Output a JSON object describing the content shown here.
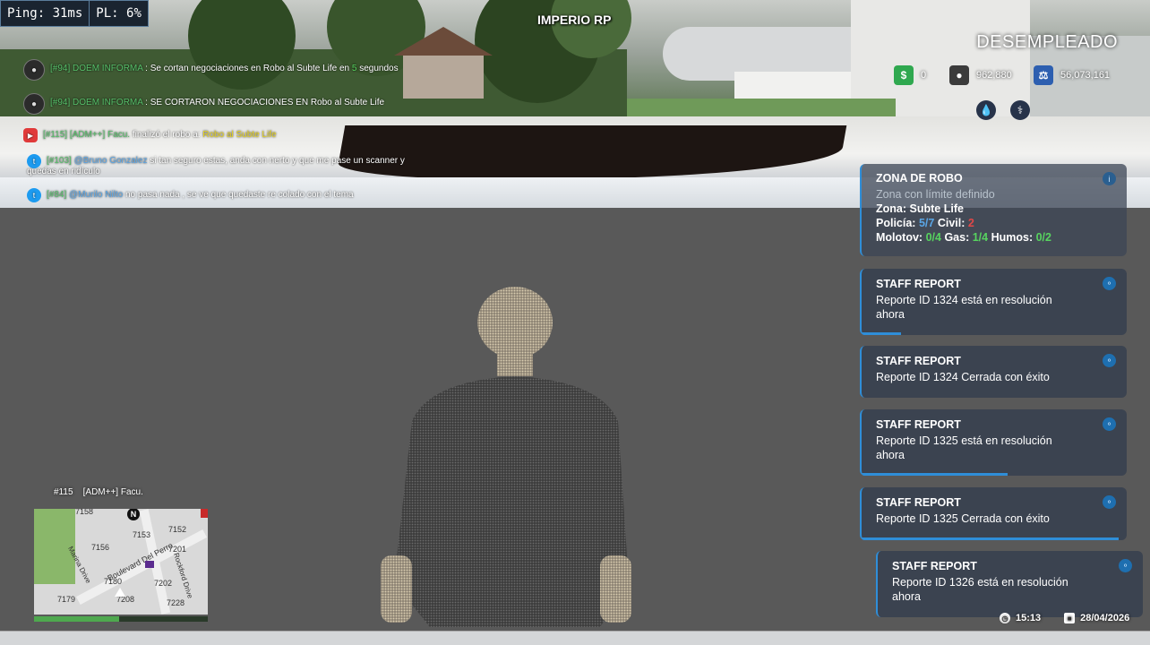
{
  "netstats": {
    "ping": "Ping: 31ms",
    "pl": "PL: 6%"
  },
  "server_name": "IMPERIO RP",
  "job": "DESEMPLEADO",
  "money": {
    "cash": "0",
    "bank_personal": "962,880",
    "bank_society": "56,073,161",
    "colors": {
      "cash": "#2fa84f",
      "person": "#3b3b3b",
      "bank": "#2d5fb0"
    }
  },
  "chat": [
    {
      "icon": "avatar",
      "tag": "[#94]",
      "sender": "DOEM INFORMA",
      "sep": " : ",
      "text": "Se cortan negociaciones en Robo al Subte Life en ",
      "highlight": "5",
      "tail": " segundos"
    },
    {
      "icon": "avatar",
      "tag": "[#94]",
      "sender": "DOEM INFORMA",
      "sep": " : ",
      "text": "SE CORTARON NEGOCIACIONES EN Robo al Subte Life",
      "highlight": "",
      "tail": ""
    },
    {
      "icon": "youtube",
      "tag": "[#115]",
      "sender": "[ADM++] Facu.",
      "sep": " ",
      "text": "finalizó el robo a: ",
      "highlight": "Robo al Subte Life",
      "tail": ""
    },
    {
      "icon": "twitter",
      "tag": "[#103]",
      "sender": "@Bruno Gonzalez",
      "sep": " ",
      "text": "si tan seguro estas, anda con nerto y que me pase un scanner y",
      "highlight": "",
      "tail": "",
      "line2": "quedas en ridículo"
    },
    {
      "icon": "twitter",
      "tag": "[#84]",
      "sender": "@Murilo Nilto",
      "sep": " ",
      "text": "no pasa nada , se ve que quedaste re colado con el tema",
      "highlight": "",
      "tail": ""
    }
  ],
  "zone": {
    "title": "ZONA DE ROBO",
    "subtitle": "Zona con límite definido",
    "zona_label": "Zona:",
    "zona_value": "Subte Life",
    "policia_label": "Policía:",
    "policia_value": "5/7",
    "civil_label": "Civil:",
    "civil_value": "2",
    "molotov_label": "Molotov:",
    "molotov_value": "0/4",
    "gas_label": "Gas:",
    "gas_value": "1/4",
    "humos_label": "Humos:",
    "humos_value": "0/2"
  },
  "reports": [
    {
      "title": "STAFF REPORT",
      "line1": "Reporte ID 1324 está en resolución",
      "line2": "ahora",
      "progress": 0.15
    },
    {
      "title": "STAFF REPORT",
      "line1": "Reporte ID 1324 Cerrada con éxito",
      "line2": "",
      "progress": 0.0
    },
    {
      "title": "STAFF REPORT",
      "line1": "Reporte ID 1325 está en resolución",
      "line2": "ahora",
      "progress": 0.55
    },
    {
      "title": "STAFF REPORT",
      "line1": "Reporte ID 1325 Cerrada con éxito",
      "line2": "",
      "progress": 0.97
    },
    {
      "title": "STAFF REPORT",
      "line1": "Reporte ID 1326 está en resolución",
      "line2": "ahora",
      "progress": 0.0
    }
  ],
  "player_plate": "#115    [ADM++] Facu.",
  "minimap": {
    "north": "N",
    "streets": [
      "7158",
      "7152",
      "7156",
      "7153",
      "7201",
      "7202",
      "7228",
      "7208",
      "7179",
      "7180",
      "Boulevard Del Perro",
      "Rockford Drive",
      "Marina Drive"
    ]
  },
  "health": 0.49,
  "time": "15:13",
  "date": "28/04/2026"
}
